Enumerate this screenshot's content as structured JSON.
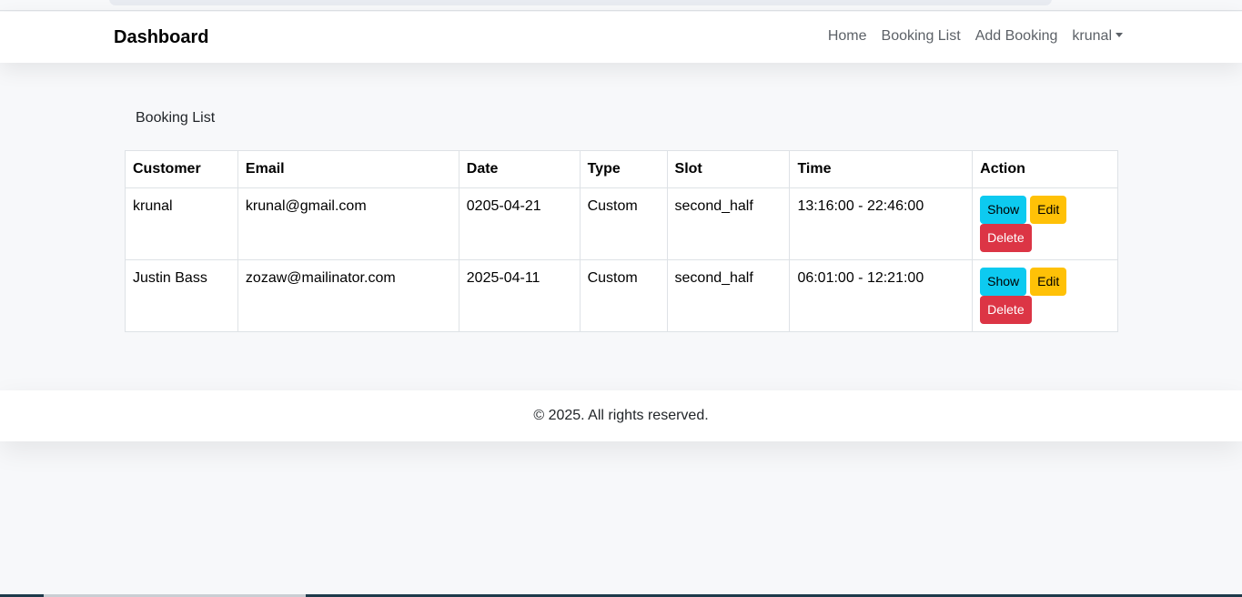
{
  "navbar": {
    "brand": "Dashboard",
    "links": [
      "Home",
      "Booking List",
      "Add Booking"
    ],
    "user": "krunal"
  },
  "page": {
    "title": "Booking List"
  },
  "table": {
    "headers": [
      "Customer",
      "Email",
      "Date",
      "Type",
      "Slot",
      "Time",
      "Action"
    ],
    "rows": [
      {
        "customer": "krunal",
        "email": "krunal@gmail.com",
        "date": "0205-04-21",
        "type": "Custom",
        "slot": "second_half",
        "time": "13:16:00 - 22:46:00"
      },
      {
        "customer": "Justin Bass",
        "email": "zozaw@mailinator.com",
        "date": "2025-04-11",
        "type": "Custom",
        "slot": "second_half",
        "time": "06:01:00 - 12:21:00"
      }
    ],
    "actions": {
      "show": "Show",
      "edit": "Edit",
      "delete": "Delete"
    }
  },
  "footer": {
    "text": "© 2025. All rights reserved."
  },
  "colors": {
    "show": "#0dcaf0",
    "edit": "#ffc107",
    "delete": "#dc3545"
  }
}
